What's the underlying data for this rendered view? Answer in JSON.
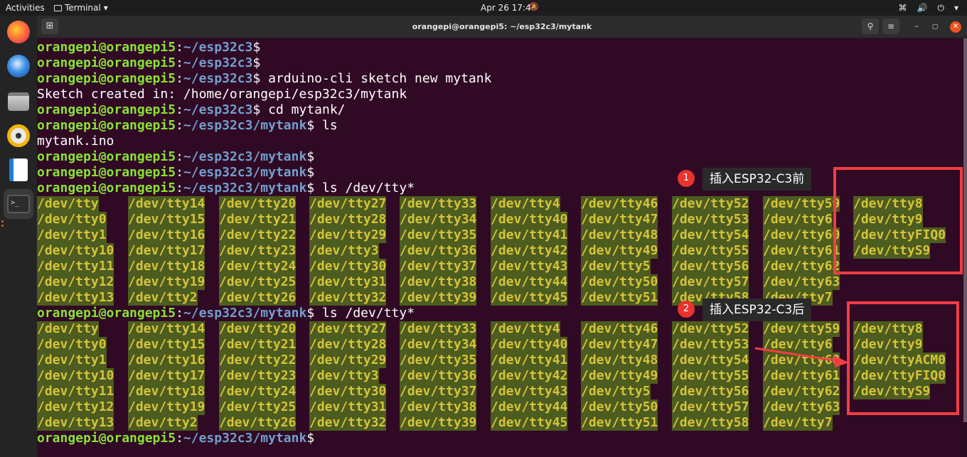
{
  "topbar": {
    "activities": "Activities",
    "app_menu": "Terminal",
    "clock": "Apr 26  17:44"
  },
  "window": {
    "title": "orangepi@orangepi5: ~/esp32c3/mytank"
  },
  "prompt": {
    "user": "orangepi@orangepi5",
    "path_base": "~/esp32c3",
    "path_tank": "~/esp32c3/mytank"
  },
  "terminal": {
    "cmd_new": " arduino-cli sketch new mytank",
    "sketch_created": "Sketch created in: /home/orangepi/esp32c3/mytank",
    "cmd_cd": " cd mytank/",
    "cmd_ls": " ls",
    "file_list": "mytank.ino",
    "cmd_ls_tty": " ls /dev/tty*",
    "listing_before": [
      [
        "/dev/tty",
        "/dev/tty0",
        "/dev/tty1",
        "/dev/tty10",
        "/dev/tty11",
        "/dev/tty12",
        "/dev/tty13"
      ],
      [
        "/dev/tty14",
        "/dev/tty15",
        "/dev/tty16",
        "/dev/tty17",
        "/dev/tty18",
        "/dev/tty19",
        "/dev/tty2"
      ],
      [
        "/dev/tty20",
        "/dev/tty21",
        "/dev/tty22",
        "/dev/tty23",
        "/dev/tty24",
        "/dev/tty25",
        "/dev/tty26"
      ],
      [
        "/dev/tty27",
        "/dev/tty28",
        "/dev/tty29",
        "/dev/tty3",
        "/dev/tty30",
        "/dev/tty31",
        "/dev/tty32"
      ],
      [
        "/dev/tty33",
        "/dev/tty34",
        "/dev/tty35",
        "/dev/tty36",
        "/dev/tty37",
        "/dev/tty38",
        "/dev/tty39"
      ],
      [
        "/dev/tty4",
        "/dev/tty40",
        "/dev/tty41",
        "/dev/tty42",
        "/dev/tty43",
        "/dev/tty44",
        "/dev/tty45"
      ],
      [
        "/dev/tty46",
        "/dev/tty47",
        "/dev/tty48",
        "/dev/tty49",
        "/dev/tty5",
        "/dev/tty50",
        "/dev/tty51"
      ],
      [
        "/dev/tty52",
        "/dev/tty53",
        "/dev/tty54",
        "/dev/tty55",
        "/dev/tty56",
        "/dev/tty57",
        "/dev/tty58"
      ],
      [
        "/dev/tty59",
        "/dev/tty6",
        "/dev/tty60",
        "/dev/tty61",
        "/dev/tty62",
        "/dev/tty63",
        "/dev/tty7"
      ],
      [
        "/dev/tty8",
        "/dev/tty9",
        "/dev/ttyFIQ0",
        "/dev/ttyS9"
      ]
    ],
    "listing_after": [
      [
        "/dev/tty",
        "/dev/tty0",
        "/dev/tty1",
        "/dev/tty10",
        "/dev/tty11",
        "/dev/tty12",
        "/dev/tty13"
      ],
      [
        "/dev/tty14",
        "/dev/tty15",
        "/dev/tty16",
        "/dev/tty17",
        "/dev/tty18",
        "/dev/tty19",
        "/dev/tty2"
      ],
      [
        "/dev/tty20",
        "/dev/tty21",
        "/dev/tty22",
        "/dev/tty23",
        "/dev/tty24",
        "/dev/tty25",
        "/dev/tty26"
      ],
      [
        "/dev/tty27",
        "/dev/tty28",
        "/dev/tty29",
        "/dev/tty3",
        "/dev/tty30",
        "/dev/tty31",
        "/dev/tty32"
      ],
      [
        "/dev/tty33",
        "/dev/tty34",
        "/dev/tty35",
        "/dev/tty36",
        "/dev/tty37",
        "/dev/tty38",
        "/dev/tty39"
      ],
      [
        "/dev/tty4",
        "/dev/tty40",
        "/dev/tty41",
        "/dev/tty42",
        "/dev/tty43",
        "/dev/tty44",
        "/dev/tty45"
      ],
      [
        "/dev/tty46",
        "/dev/tty47",
        "/dev/tty48",
        "/dev/tty49",
        "/dev/tty5",
        "/dev/tty50",
        "/dev/tty51"
      ],
      [
        "/dev/tty52",
        "/dev/tty53",
        "/dev/tty54",
        "/dev/tty55",
        "/dev/tty56",
        "/dev/tty57",
        "/dev/tty58"
      ],
      [
        "/dev/tty59",
        "/dev/tty6",
        "/dev/tty60",
        "/dev/tty61",
        "/dev/tty62",
        "/dev/tty63",
        "/dev/tty7"
      ],
      [
        "/dev/tty8",
        "/dev/tty9",
        "/dev/ttyACM0",
        "/dev/ttyFIQ0",
        "/dev/ttyS9"
      ]
    ]
  },
  "annotations": {
    "badge1": "1",
    "note1": "插入ESP32-C3前",
    "badge2": "2",
    "note2": "插入ESP32-C3后",
    "color": "#f23d44"
  },
  "colors": {
    "background": "#300a24",
    "prompt_user": "#8ae234",
    "prompt_path": "#729fcf",
    "tty_text": "#d5c43a",
    "tty_bg": "#4d5c1f"
  },
  "icons": {
    "dock": [
      "firefox-icon",
      "thunderbird-icon",
      "files-icon",
      "rhythmbox-icon",
      "writer-icon",
      "terminal-icon"
    ]
  }
}
